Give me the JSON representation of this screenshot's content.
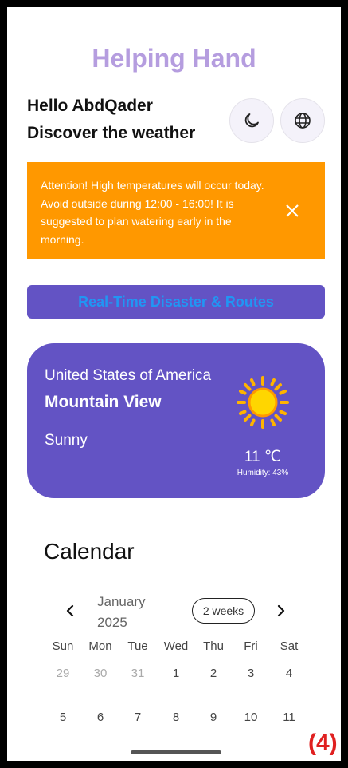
{
  "app": {
    "title": "Helping Hand"
  },
  "header": {
    "greeting": "Hello AbdQader",
    "subtitle": "Discover the weather",
    "theme_icon": "moon-icon",
    "language_icon": "globe-icon"
  },
  "alert": {
    "text": "Attention! High temperatures will occur today. Avoid outside during 12:00 - 16:00! It is suggested to plan watering early in the morning.",
    "close_icon": "close-icon",
    "color": "#ff9800"
  },
  "disaster_button": {
    "label": "Real-Time Disaster & Routes"
  },
  "weather": {
    "country": "United States of America",
    "city": "Mountain View",
    "condition": "Sunny",
    "icon": "sun-icon",
    "temperature": "11 ℃",
    "humidity": "Humidity: 43%",
    "card_color": "#6353c4"
  },
  "calendar": {
    "title": "Calendar",
    "month_line1": "January",
    "month_line2": "2025",
    "format_label": "2 weeks",
    "weekdays": [
      "Sun",
      "Mon",
      "Tue",
      "Wed",
      "Thu",
      "Fri",
      "Sat"
    ],
    "rows": [
      [
        {
          "day": "29",
          "outside": true
        },
        {
          "day": "30",
          "outside": true
        },
        {
          "day": "31",
          "outside": true
        },
        {
          "day": "1",
          "outside": false
        },
        {
          "day": "2",
          "outside": false
        },
        {
          "day": "3",
          "outside": false
        },
        {
          "day": "4",
          "outside": false
        }
      ],
      [
        {
          "day": "5",
          "outside": false
        },
        {
          "day": "6",
          "outside": false
        },
        {
          "day": "7",
          "outside": false
        },
        {
          "day": "8",
          "outside": false
        },
        {
          "day": "9",
          "outside": false
        },
        {
          "day": "10",
          "outside": false
        },
        {
          "day": "11",
          "outside": false
        }
      ]
    ]
  },
  "screenshot_label": "(4)"
}
